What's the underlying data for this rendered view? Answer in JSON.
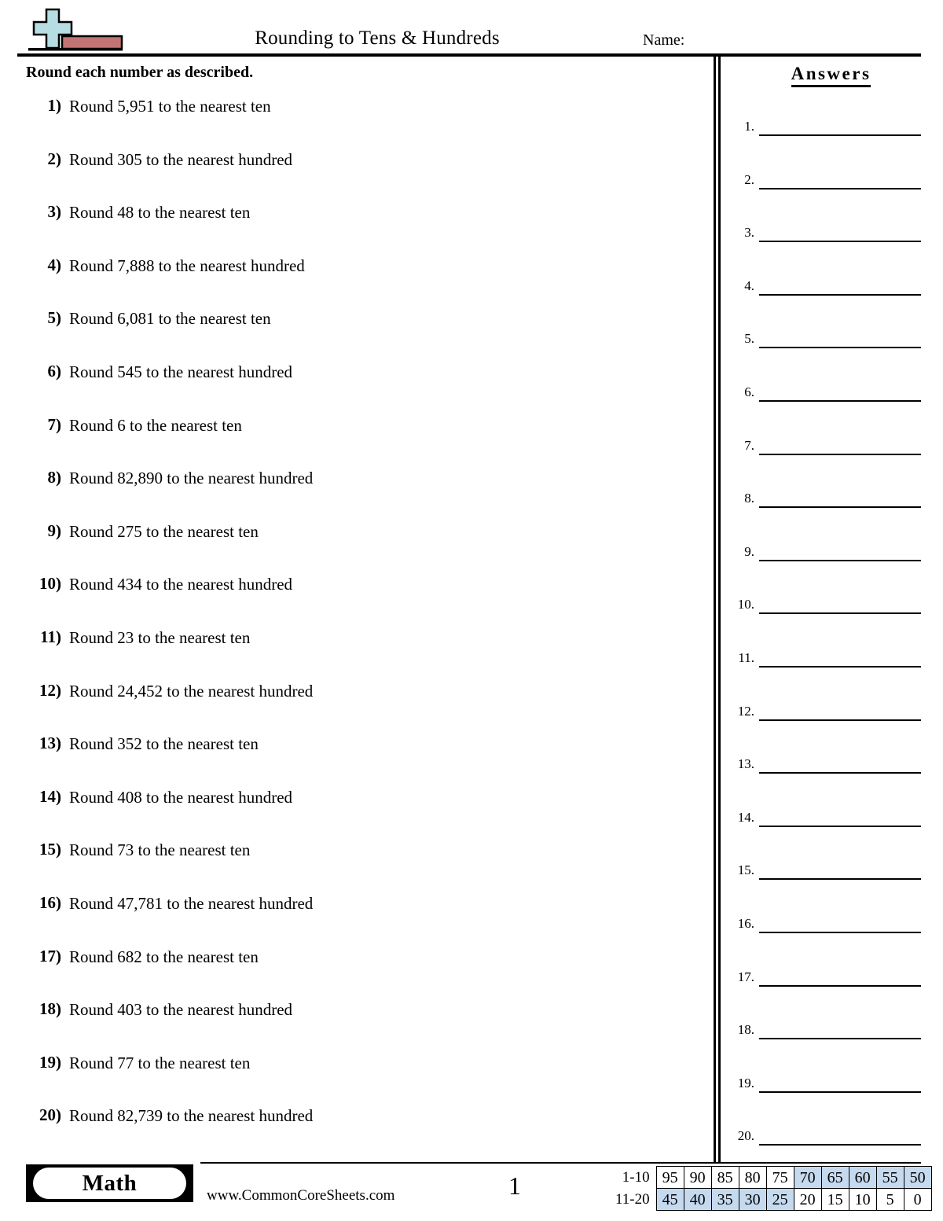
{
  "header": {
    "title": "Rounding to Tens & Hundreds",
    "name_label": "Name:",
    "logo_icon": "plus-minus-blocks-icon",
    "logo_plus_color": "#b5dde2",
    "logo_bar_color": "#c27474"
  },
  "instructions": "Round each number as described.",
  "questions": [
    {
      "number": "1)",
      "text": "Round 5,951 to the nearest ten"
    },
    {
      "number": "2)",
      "text": "Round 305 to the nearest hundred"
    },
    {
      "number": "3)",
      "text": "Round 48 to the nearest ten"
    },
    {
      "number": "4)",
      "text": "Round 7,888 to the nearest hundred"
    },
    {
      "number": "5)",
      "text": "Round 6,081 to the nearest ten"
    },
    {
      "number": "6)",
      "text": "Round 545 to the nearest hundred"
    },
    {
      "number": "7)",
      "text": "Round 6 to the nearest ten"
    },
    {
      "number": "8)",
      "text": "Round 82,890 to the nearest hundred"
    },
    {
      "number": "9)",
      "text": "Round 275 to the nearest ten"
    },
    {
      "number": "10)",
      "text": "Round 434 to the nearest hundred"
    },
    {
      "number": "11)",
      "text": "Round 23 to the nearest ten"
    },
    {
      "number": "12)",
      "text": "Round 24,452 to the nearest hundred"
    },
    {
      "number": "13)",
      "text": "Round 352 to the nearest ten"
    },
    {
      "number": "14)",
      "text": "Round 408 to the nearest hundred"
    },
    {
      "number": "15)",
      "text": "Round 73 to the nearest ten"
    },
    {
      "number": "16)",
      "text": "Round 47,781 to the nearest hundred"
    },
    {
      "number": "17)",
      "text": "Round 682 to the nearest ten"
    },
    {
      "number": "18)",
      "text": "Round 403 to the nearest hundred"
    },
    {
      "number": "19)",
      "text": "Round 77 to the nearest ten"
    },
    {
      "number": "20)",
      "text": "Round 82,739 to the nearest hundred"
    }
  ],
  "answers": {
    "title": "Answers",
    "rows": [
      {
        "number": "1.",
        "value": ""
      },
      {
        "number": "2.",
        "value": ""
      },
      {
        "number": "3.",
        "value": ""
      },
      {
        "number": "4.",
        "value": ""
      },
      {
        "number": "5.",
        "value": ""
      },
      {
        "number": "6.",
        "value": ""
      },
      {
        "number": "7.",
        "value": ""
      },
      {
        "number": "8.",
        "value": ""
      },
      {
        "number": "9.",
        "value": ""
      },
      {
        "number": "10.",
        "value": ""
      },
      {
        "number": "11.",
        "value": ""
      },
      {
        "number": "12.",
        "value": ""
      },
      {
        "number": "13.",
        "value": ""
      },
      {
        "number": "14.",
        "value": ""
      },
      {
        "number": "15.",
        "value": ""
      },
      {
        "number": "16.",
        "value": ""
      },
      {
        "number": "17.",
        "value": ""
      },
      {
        "number": "18.",
        "value": ""
      },
      {
        "number": "19.",
        "value": ""
      },
      {
        "number": "20.",
        "value": ""
      }
    ]
  },
  "footer": {
    "badge_label": "Math",
    "site_url": "www.CommonCoreSheets.com",
    "page_number": "1"
  },
  "score_table": {
    "highlight_color": "#c5d9ef",
    "rows": [
      {
        "label": "1-10",
        "cells": [
          {
            "value": "95",
            "highlighted": false
          },
          {
            "value": "90",
            "highlighted": false
          },
          {
            "value": "85",
            "highlighted": false
          },
          {
            "value": "80",
            "highlighted": false
          },
          {
            "value": "75",
            "highlighted": false
          },
          {
            "value": "70",
            "highlighted": true
          },
          {
            "value": "65",
            "highlighted": true
          },
          {
            "value": "60",
            "highlighted": true
          },
          {
            "value": "55",
            "highlighted": true
          },
          {
            "value": "50",
            "highlighted": true
          }
        ]
      },
      {
        "label": "11-20",
        "cells": [
          {
            "value": "45",
            "highlighted": true
          },
          {
            "value": "40",
            "highlighted": true
          },
          {
            "value": "35",
            "highlighted": true
          },
          {
            "value": "30",
            "highlighted": true
          },
          {
            "value": "25",
            "highlighted": true
          },
          {
            "value": "20",
            "highlighted": false
          },
          {
            "value": "15",
            "highlighted": false
          },
          {
            "value": "10",
            "highlighted": false
          },
          {
            "value": "5",
            "highlighted": false
          },
          {
            "value": "0",
            "highlighted": false
          }
        ]
      }
    ]
  }
}
